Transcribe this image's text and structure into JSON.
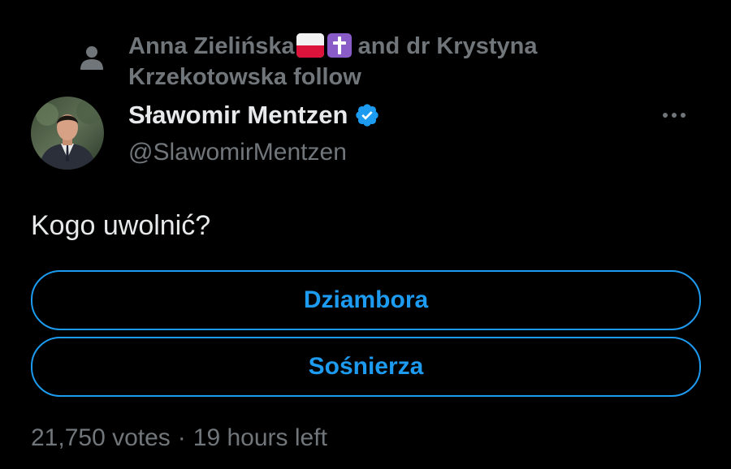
{
  "social_context": {
    "icon": "person-icon",
    "first_name": "Anna Zielińska",
    "first_name_emoji_1": "poland-flag",
    "first_name_emoji_2": "latin-cross",
    "suffix_line_1": "and dr Krystyna",
    "suffix_line_2": "Krzekotowska follow"
  },
  "author": {
    "display_name": "Sławomir Mentzen",
    "verified": true,
    "handle": "@SlawomirMentzen",
    "avatar_icon": "avatar"
  },
  "tweet": {
    "text": "Kogo uwolnić?"
  },
  "poll": {
    "options": [
      {
        "label": "Dziambora"
      },
      {
        "label": "Sośnierza"
      }
    ],
    "votes": "21,750 votes",
    "separator": "·",
    "time_left": "19 hours left"
  },
  "colors": {
    "background": "#000000",
    "primary_text": "#e7e9ea",
    "secondary_text": "#71767b",
    "accent": "#1d9bf0"
  }
}
